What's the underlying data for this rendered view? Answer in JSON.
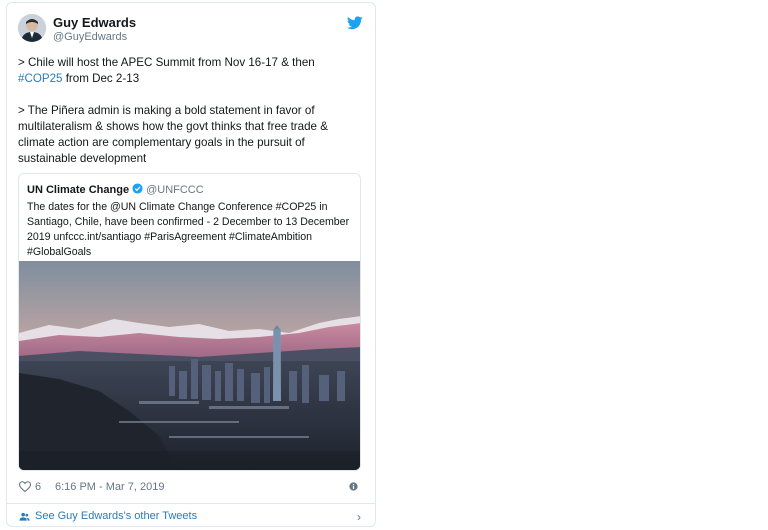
{
  "tweet": {
    "author_name": "Guy Edwards",
    "author_handle": "@GuyEdwards",
    "para1_text": "> Chile will host the APEC Summit from Nov 16-17 & then ",
    "para1_hashtag": "#COP25",
    "para1_end": " from Dec 2-13",
    "para2_text": "> The Piñera admin is making a bold statement in favor of multilateralism & shows how the govt thinks that free trade & climate action are complementary goals in the pursuit of sustainable development",
    "likes": "6",
    "separator": "·",
    "timestamp": "6:16 PM - Mar 7, 2019"
  },
  "quote": {
    "name": "UN Climate Change",
    "handle": "@UNFCCC",
    "text": "The dates for the @UN Climate Change Conference #COP25 in Santiago, Chile, have been confirmed - 2 December to 13 December 2019 unfccc.int/santiago #ParisAgreement #ClimateAmbition #GlobalGoals"
  },
  "footer": {
    "link_text": "See Guy Edwards's other Tweets",
    "chevron": "›"
  },
  "icons": {
    "brand": "twitter-bird-icon",
    "verified": "verified-badge-icon",
    "like": "heart-icon",
    "info": "info-icon",
    "profile": "people-icon"
  },
  "colors": {
    "link_blue": "#2b7bb9",
    "twitter_blue": "#1da1f2",
    "text": "#14171a",
    "muted": "#657786",
    "border": "#e1e8ed"
  }
}
